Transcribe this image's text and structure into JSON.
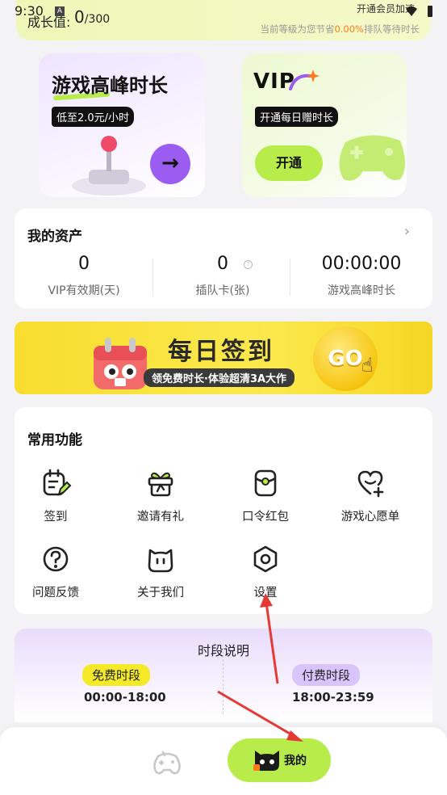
{
  "status": {
    "time": "9:30",
    "a_badge": "A"
  },
  "level": {
    "label": "成长值:",
    "value": "0",
    "max": "/300",
    "member_link": "开通会员加速",
    "note_prefix": "当前等级为您节省",
    "note_percent": "0.00%",
    "note_suffix": "排队等待时长"
  },
  "promo": {
    "left": {
      "title": "游戏高峰时长",
      "tag": "低至2.0元/小时",
      "arrow": "→"
    },
    "right": {
      "title": "VIP",
      "tag": "开通每日赠时长",
      "button": "开通"
    }
  },
  "assets": {
    "title": "我的资产",
    "chevron": "›",
    "stats": [
      {
        "value": "0",
        "label": "VIP有效期(天)"
      },
      {
        "value": "0",
        "label": "插队卡(张)"
      },
      {
        "value": "00:00:00",
        "label": "游戏高峰时长"
      }
    ],
    "info": "?"
  },
  "signin": {
    "title": "每日签到",
    "subtitle": "领免费时长·体验超清3A大作",
    "go": "GO"
  },
  "functions": {
    "title": "常用功能",
    "items": [
      {
        "label": "签到",
        "icon": "calendar-edit-icon"
      },
      {
        "label": "邀请有礼",
        "icon": "gift-icon"
      },
      {
        "label": "口令红包",
        "icon": "red-packet-icon"
      },
      {
        "label": "游戏心愿单",
        "icon": "heart-plus-icon"
      },
      {
        "label": "问题反馈",
        "icon": "question-icon"
      },
      {
        "label": "关于我们",
        "icon": "cat-face-icon"
      },
      {
        "label": "设置",
        "icon": "settings-hexagon-icon"
      }
    ]
  },
  "time_info": {
    "title": "时段说明",
    "free_tag": "免费时段",
    "free_range": "00:00-18:00",
    "paid_tag": "付费时段",
    "paid_range": "18:00-23:59"
  },
  "nav": {
    "game_icon": "gamepad-icon",
    "mine_label": "我的"
  },
  "colors": {
    "accent_green": "#b7ec4a",
    "accent_purple": "#9b5cf2",
    "accent_yellow": "#f8dd2e",
    "orange": "#ff7a1a",
    "annotation_red": "#e53935"
  }
}
